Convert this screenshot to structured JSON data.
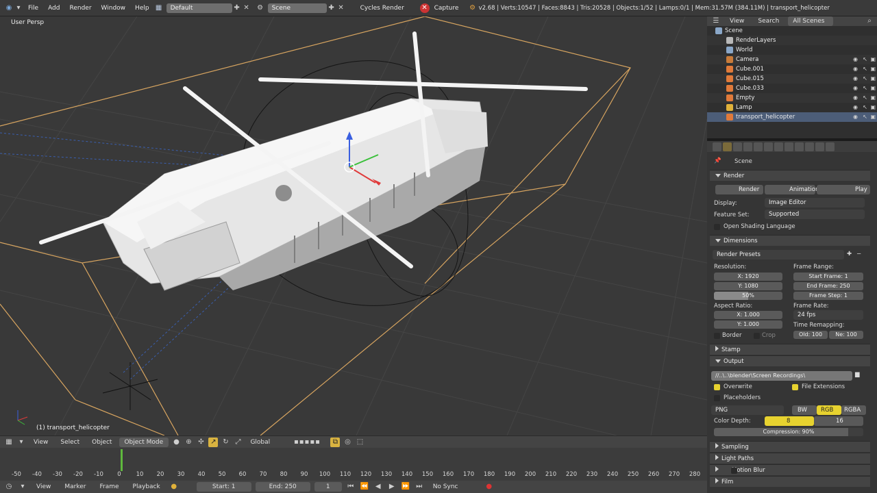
{
  "topbar": {
    "menus": [
      "File",
      "Add",
      "Render",
      "Window",
      "Help"
    ],
    "layout": "Default",
    "scene": "Scene",
    "engine": "Cycles Render",
    "capture": "Capture",
    "stats": "v2.68 | Verts:10547 | Faces:8843 | Tris:20528 | Objects:1/52 | Lamps:0/1 | Mem:31.57M (384.11M) | transport_helicopter"
  },
  "viewport": {
    "view_label": "User Persp",
    "object_label": "(1) transport_helicopter"
  },
  "view3d_header": {
    "items": [
      "View",
      "Select",
      "Object"
    ],
    "mode": "Object Mode",
    "orientation": "Global"
  },
  "timeline": {
    "ticks": [
      "-50",
      "-40",
      "-30",
      "-20",
      "-10",
      "0",
      "10",
      "20",
      "30",
      "40",
      "50",
      "60",
      "70",
      "80",
      "90",
      "100",
      "110",
      "120",
      "130",
      "140",
      "150",
      "160",
      "170",
      "180",
      "190",
      "200",
      "210",
      "220",
      "230",
      "240",
      "250",
      "260",
      "270",
      "280"
    ],
    "current_frame": 1,
    "header": {
      "items": [
        "View",
        "Marker",
        "Frame",
        "Playback"
      ],
      "start": "Start: 1",
      "end": "End: 250",
      "frame": "1",
      "sync": "No Sync"
    }
  },
  "outliner": {
    "header": [
      "View",
      "Search",
      "All Scenes"
    ],
    "rows": [
      {
        "label": "Scene",
        "icon_color": "#8aa7c8"
      },
      {
        "label": "RenderLayers",
        "icon_color": "#b9b9b9"
      },
      {
        "label": "World",
        "icon_color": "#8aa7c8"
      },
      {
        "label": "Camera",
        "icon_color": "#c97b3a"
      },
      {
        "label": "Cube.001",
        "icon_color": "#e07a3a"
      },
      {
        "label": "Cube.015",
        "icon_color": "#e07a3a"
      },
      {
        "label": "Cube.033",
        "icon_color": "#e07a3a"
      },
      {
        "label": "Empty",
        "icon_color": "#e07a3a"
      },
      {
        "label": "Lamp",
        "icon_color": "#e0b13a"
      },
      {
        "label": "transport_helicopter",
        "icon_color": "#e07a3a"
      }
    ]
  },
  "properties": {
    "context": "Scene",
    "render_panel": "Render",
    "render_btn": "Render",
    "animation_btn": "Animation",
    "play_btn": "Play",
    "display_label": "Display:",
    "display_value": "Image Editor",
    "feature_label": "Feature Set:",
    "feature_value": "Supported",
    "osl": "Open Shading Language",
    "dimensions": "Dimensions",
    "presets": "Render Presets",
    "resolution": "Resolution:",
    "res_x": "X: 1920",
    "res_y": "Y: 1080",
    "res_pct": "50%",
    "frame_range": "Frame Range:",
    "start_frame": "Start Frame: 1",
    "end_frame": "End Frame: 250",
    "frame_step": "Frame Step: 1",
    "aspect": "Aspect Ratio:",
    "asp_x": "X: 1.000",
    "asp_y": "Y: 1.000",
    "frame_rate": "Frame Rate:",
    "fps": "24 fps",
    "time_remap": "Time Remapping:",
    "old": "Old: 100",
    "new": "Ne: 100",
    "border": "Border",
    "crop": "Crop",
    "stamp": "Stamp",
    "output": "Output",
    "path": "//..\\..\\blender\\Screen Recordings\\",
    "overwrite": "Overwrite",
    "file_ext": "File Extensions",
    "placeholders": "Placeholders",
    "format": "PNG",
    "bw": "BW",
    "rgb": "RGB",
    "rgba": "RGBA",
    "depth_label": "Color Depth:",
    "depth_8": "8",
    "depth_16": "16",
    "compression": "Compression: 90%",
    "sampling": "Sampling",
    "light_paths": "Light Paths",
    "motion_blur": "Motion Blur",
    "film": "Film"
  }
}
